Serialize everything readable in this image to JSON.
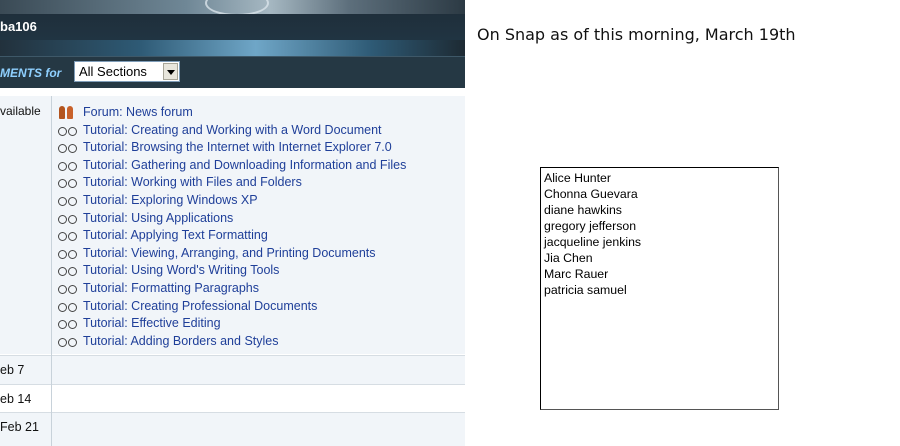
{
  "course": {
    "code_fragment": "ba106"
  },
  "filter": {
    "label": "MENTS for",
    "selected_section": "All Sections"
  },
  "topic": {
    "availability_label": "vailable",
    "activities": [
      {
        "type": "forum",
        "icon": "forum-icon",
        "label": "Forum: News forum"
      },
      {
        "type": "tutorial",
        "icon": "goggles-icon",
        "label": "Tutorial: Creating and Working with a Word Document"
      },
      {
        "type": "tutorial",
        "icon": "goggles-icon",
        "label": "Tutorial: Browsing the Internet with Internet Explorer 7.0"
      },
      {
        "type": "tutorial",
        "icon": "goggles-icon",
        "label": "Tutorial: Gathering and Downloading Information and Files"
      },
      {
        "type": "tutorial",
        "icon": "goggles-icon",
        "label": "Tutorial: Working with Files and Folders"
      },
      {
        "type": "tutorial",
        "icon": "goggles-icon",
        "label": "Tutorial: Exploring Windows XP"
      },
      {
        "type": "tutorial",
        "icon": "goggles-icon",
        "label": "Tutorial: Using Applications"
      },
      {
        "type": "tutorial",
        "icon": "goggles-icon",
        "label": "Tutorial: Applying Text Formatting"
      },
      {
        "type": "tutorial",
        "icon": "goggles-icon",
        "label": "Tutorial: Viewing, Arranging, and Printing Documents"
      },
      {
        "type": "tutorial",
        "icon": "goggles-icon",
        "label": "Tutorial: Using Word's Writing Tools"
      },
      {
        "type": "tutorial",
        "icon": "goggles-icon",
        "label": "Tutorial: Formatting Paragraphs"
      },
      {
        "type": "tutorial",
        "icon": "goggles-icon",
        "label": "Tutorial: Creating Professional Documents"
      },
      {
        "type": "tutorial",
        "icon": "goggles-icon",
        "label": "Tutorial: Effective Editing"
      },
      {
        "type": "tutorial",
        "icon": "goggles-icon",
        "label": "Tutorial: Adding Borders and Styles"
      }
    ]
  },
  "weeks": [
    "eb 7",
    "eb 14",
    "Feb 21"
  ],
  "note": "On Snap as of this morning, March 19th",
  "names": [
    "Alice Hunter",
    "Chonna Guevara",
    "diane hawkins",
    "gregory jefferson",
    "jacqueline jenkins",
    "Jia Chen",
    "Marc Rauer",
    "patricia samuel"
  ],
  "colors": {
    "link": "#1f3f99",
    "header_dark": "#253844",
    "filter_label": "#8fd0ff",
    "row_bg": "#f1f5f9"
  }
}
